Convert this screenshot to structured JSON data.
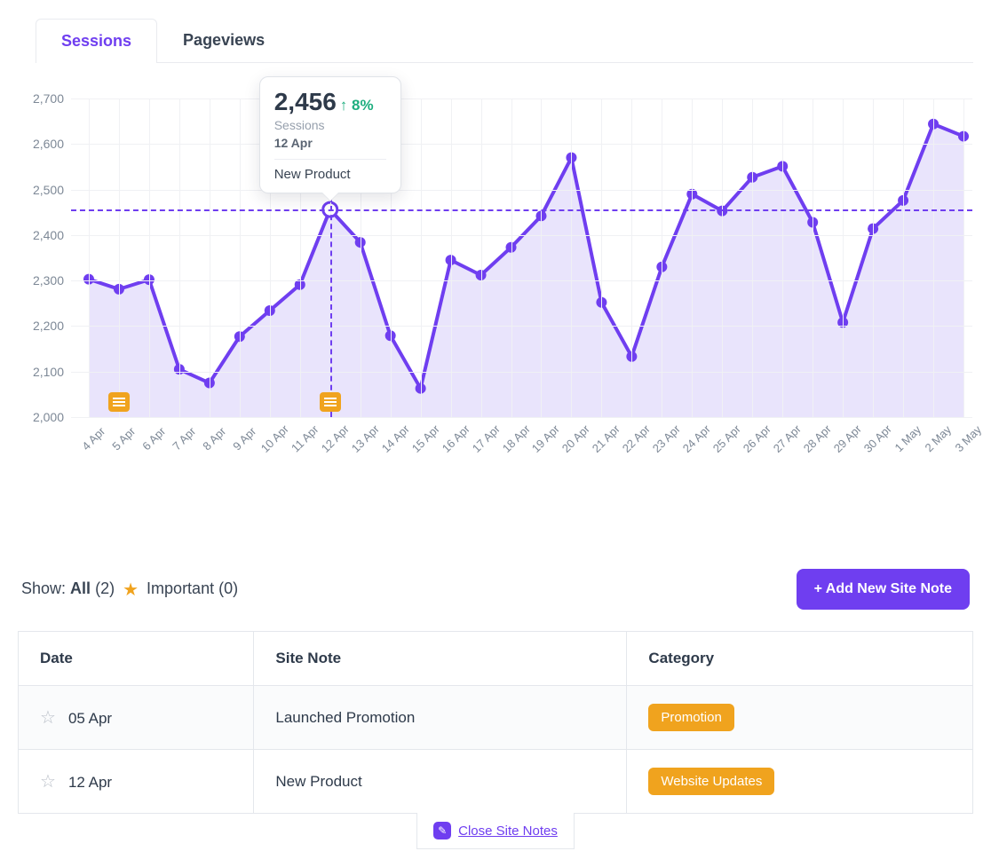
{
  "tabs": {
    "sessions": "Sessions",
    "pageviews": "Pageviews",
    "active": "sessions"
  },
  "tooltip": {
    "value": "2,456",
    "delta_arrow": "↑",
    "delta": "8%",
    "metric": "Sessions",
    "date": "12 Apr",
    "note": "New Product"
  },
  "chart_data": {
    "type": "line",
    "title": "",
    "xlabel": "",
    "ylabel": "",
    "ylim": [
      2000,
      2700
    ],
    "yticks": [
      2000,
      2100,
      2200,
      2300,
      2400,
      2500,
      2600,
      2700
    ],
    "categories": [
      "4 Apr",
      "5 Apr",
      "6 Apr",
      "7 Apr",
      "8 Apr",
      "9 Apr",
      "10 Apr",
      "11 Apr",
      "12 Apr",
      "13 Apr",
      "14 Apr",
      "15 Apr",
      "16 Apr",
      "17 Apr",
      "18 Apr",
      "19 Apr",
      "20 Apr",
      "21 Apr",
      "22 Apr",
      "23 Apr",
      "24 Apr",
      "25 Apr",
      "26 Apr",
      "27 Apr",
      "28 Apr",
      "29 Apr",
      "30 Apr",
      "1 May",
      "2 May",
      "3 May"
    ],
    "series": [
      {
        "name": "Sessions",
        "values": [
          2303,
          2281,
          2302,
          2105,
          2075,
          2177,
          2234,
          2291,
          2456,
          2384,
          2179,
          2063,
          2345,
          2312,
          2373,
          2442,
          2570,
          2252,
          2133,
          2330,
          2490,
          2453,
          2527,
          2551,
          2428,
          2208,
          2414,
          2476,
          2644,
          2617
        ]
      }
    ],
    "highlight_index": 8,
    "note_markers": [
      1,
      8
    ]
  },
  "notes_header": {
    "show_label": "Show:",
    "all_label": "All",
    "all_count": "(2)",
    "important_label": "Important",
    "important_count": "(0)",
    "add_button": "+ Add New Site Note"
  },
  "notes_table": {
    "columns": {
      "date": "Date",
      "note": "Site Note",
      "category": "Category"
    },
    "rows": [
      {
        "date": "05 Apr",
        "note": "Launched Promotion",
        "category": "Promotion"
      },
      {
        "date": "12 Apr",
        "note": "New Product",
        "category": "Website Updates"
      }
    ]
  },
  "close_notes_label": "Close Site Notes"
}
